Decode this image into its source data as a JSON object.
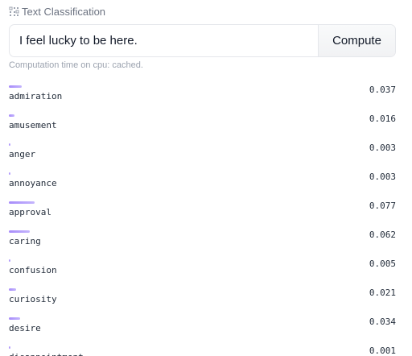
{
  "header": {
    "title": "Text Classification",
    "icon": "text-classification-icon"
  },
  "input": {
    "value": "I feel lucky to be here."
  },
  "compute_button": {
    "label": "Compute"
  },
  "status": {
    "text": "Computation time on cpu: cached."
  },
  "results": [
    {
      "label": "admiration",
      "score": "0.037",
      "value": 0.037
    },
    {
      "label": "amusement",
      "score": "0.016",
      "value": 0.016
    },
    {
      "label": "anger",
      "score": "0.003",
      "value": 0.003
    },
    {
      "label": "annoyance",
      "score": "0.003",
      "value": 0.003
    },
    {
      "label": "approval",
      "score": "0.077",
      "value": 0.077
    },
    {
      "label": "caring",
      "score": "0.062",
      "value": 0.062
    },
    {
      "label": "confusion",
      "score": "0.005",
      "value": 0.005
    },
    {
      "label": "curiosity",
      "score": "0.021",
      "value": 0.021
    },
    {
      "label": "desire",
      "score": "0.034",
      "value": 0.034
    },
    {
      "label": "disappointment",
      "score": "0.001",
      "value": 0.001
    }
  ],
  "colors": {
    "bar_start": "#a78bfa",
    "bar_end": "#c4b5fd"
  }
}
